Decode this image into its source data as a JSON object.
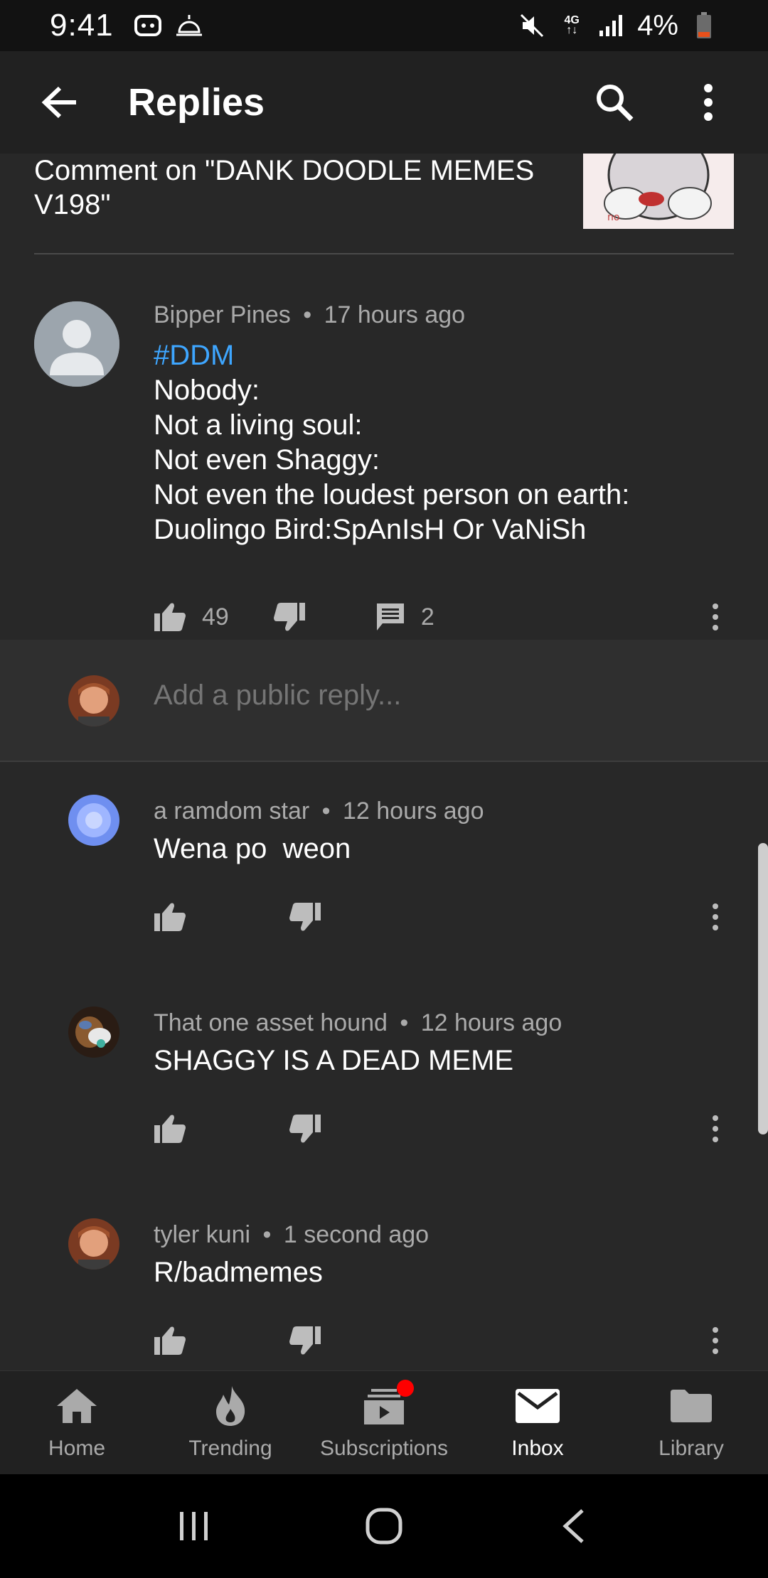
{
  "status_bar": {
    "time": "9:41",
    "battery": "4%"
  },
  "app_bar": {
    "title": "Replies"
  },
  "video_ref": {
    "text": "Comment on \"DANK DOODLE MEMES V198\"",
    "thumb_caption": "no"
  },
  "main_comment": {
    "author": "Bipper Pines",
    "age": "17 hours ago",
    "tag": "#DDM",
    "lines": [
      "Nobody:",
      "Not a living soul:",
      "Not even Shaggy:",
      "Not even the loudest person on earth:",
      "Duolingo Bird:SpAnIsH Or VaNiSh"
    ],
    "likes": "49",
    "replies": "2"
  },
  "reply_box": {
    "placeholder": "Add a public reply..."
  },
  "replies": [
    {
      "author": "a ramdom star",
      "age": "12 hours ago",
      "text": "Wena po  weon"
    },
    {
      "author": "That one asset hound",
      "age": "12 hours ago",
      "text": "SHAGGY IS A DEAD MEME"
    },
    {
      "author": "tyler kuni",
      "age": "1 second ago",
      "text": "R/badmemes"
    }
  ],
  "meta_separator": "•",
  "bottom_nav": {
    "items": [
      {
        "label": "Home",
        "icon": "home-icon"
      },
      {
        "label": "Trending",
        "icon": "flame-icon"
      },
      {
        "label": "Subscriptions",
        "icon": "subscriptions-icon"
      },
      {
        "label": "Inbox",
        "icon": "mail-icon"
      },
      {
        "label": "Library",
        "icon": "folder-icon"
      }
    ],
    "active": "Inbox"
  },
  "colors": {
    "link": "#3ea6ff",
    "notif_dot": "#ff0000",
    "background": "#282828"
  }
}
